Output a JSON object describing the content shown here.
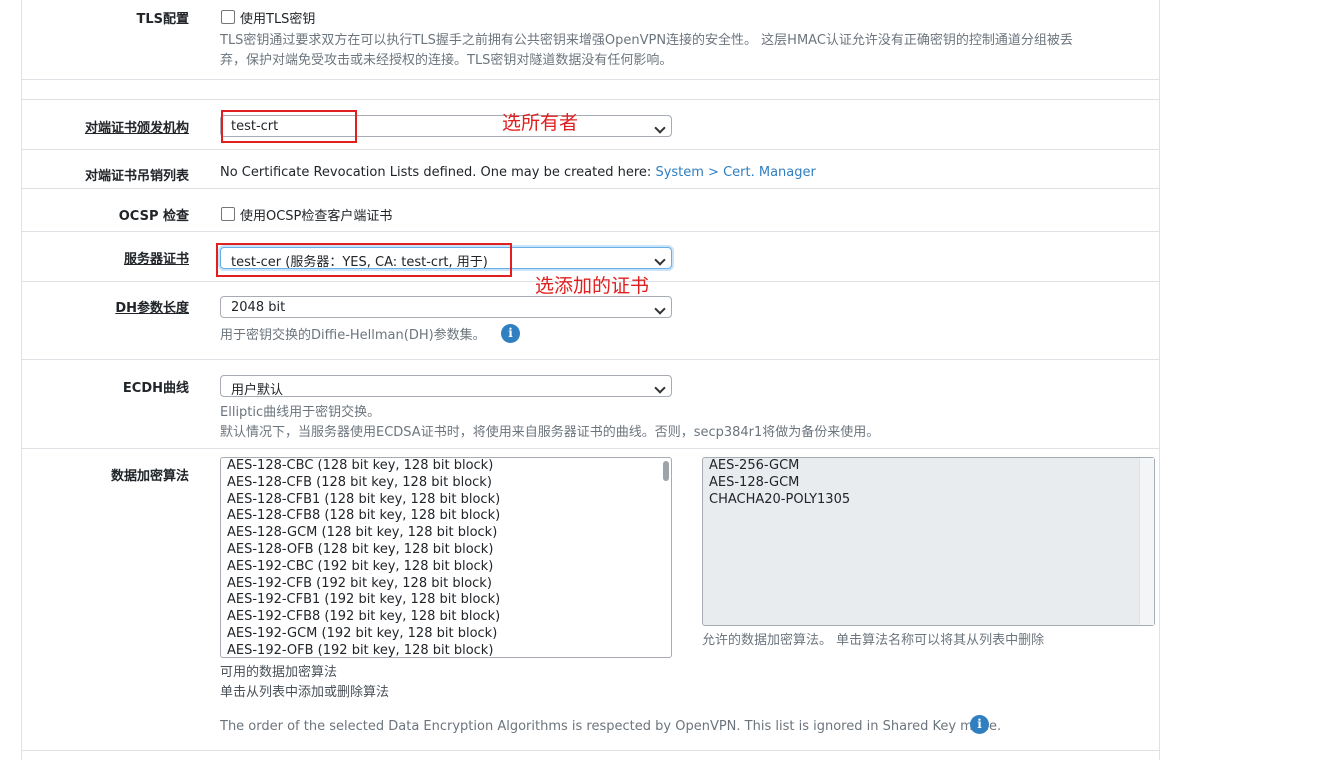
{
  "tls": {
    "label": "TLS配置",
    "checkbox_label": "使用TLS密钥",
    "help_line1": "TLS密钥通过要求双方在可以执行TLS握手之前拥有公共密钥来增强OpenVPN连接的安全性。 这层HMAC认证允许没有正确密钥的控制通道分组被丢",
    "help_line2": "弃，保护对端免受攻击或未经授权的连接。TLS密钥对隧道数据没有任何影响。"
  },
  "peer_ca": {
    "label": "对端证书颁发机构",
    "value": "test-crt",
    "annotation": "选所有者"
  },
  "peer_crl": {
    "label": "对端证书吊销列表",
    "text": "No Certificate Revocation Lists defined. One may be created here: ",
    "link": "System > Cert. Manager"
  },
  "ocsp": {
    "label": "OCSP 检查",
    "checkbox_label": "使用OCSP检查客户端证书"
  },
  "server_cert": {
    "label": "服务器证书",
    "value": "test-cer (服务器：YES, CA: test-crt, 用于)",
    "annotation": "选添加的证书"
  },
  "dh": {
    "label": "DH参数长度",
    "value": "2048 bit",
    "help": "用于密钥交换的Diffie-Hellman(DH)参数集。"
  },
  "ecdh": {
    "label": "ECDH曲线",
    "value": "用户默认",
    "help_line1": "Elliptic曲线用于密钥交换。",
    "help_line2": "默认情况下，当服务器使用ECDSA证书时，将使用来自服务器证书的曲线。否则，secp384r1将做为备份来使用。"
  },
  "encryption": {
    "label": "数据加密算法",
    "available": [
      "AES-128-CBC (128 bit key, 128 bit block)",
      "AES-128-CFB (128 bit key, 128 bit block)",
      "AES-128-CFB1 (128 bit key, 128 bit block)",
      "AES-128-CFB8 (128 bit key, 128 bit block)",
      "AES-128-GCM (128 bit key, 128 bit block)",
      "AES-128-OFB (128 bit key, 128 bit block)",
      "AES-192-CBC (192 bit key, 128 bit block)",
      "AES-192-CFB (192 bit key, 128 bit block)",
      "AES-192-CFB1 (192 bit key, 128 bit block)",
      "AES-192-CFB8 (192 bit key, 128 bit block)",
      "AES-192-GCM (192 bit key, 128 bit block)",
      "AES-192-OFB (192 bit key, 128 bit block)"
    ],
    "selected": [
      "AES-256-GCM",
      "AES-128-GCM",
      "CHACHA20-POLY1305"
    ],
    "available_help_line1": "可用的数据加密算法",
    "available_help_line2": "单击从列表中添加或删除算法",
    "selected_help": "允许的数据加密算法。 单击算法名称可以将其从列表中删除",
    "order_note": "The order of the selected Data Encryption Algorithms is respected by OpenVPN. This list is ignored in Shared Key mode."
  },
  "colors": {
    "annotation": "#e02020",
    "link": "#2f7fc1",
    "info": "#2f7fc1"
  },
  "icons": {
    "info": "info-icon",
    "chevron": "chevron-down-icon"
  }
}
